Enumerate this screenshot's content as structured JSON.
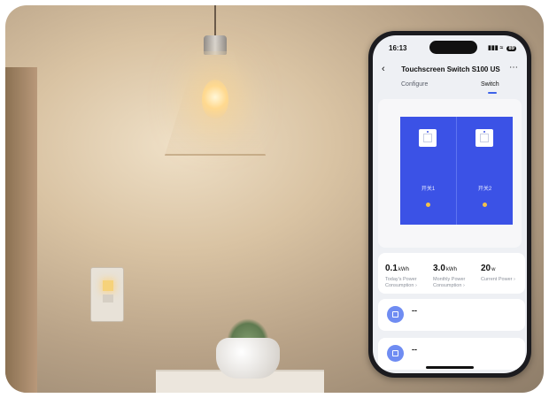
{
  "status": {
    "time": "16:13",
    "signal_icon": "signal-icon",
    "wifi_icon": "wifi-icon",
    "battery": "89"
  },
  "header": {
    "title": "Touchscreen Switch S100 US"
  },
  "tabs": [
    {
      "label": "Configure",
      "active": false
    },
    {
      "label": "Switch",
      "active": true
    }
  ],
  "device": {
    "switches": [
      {
        "label": "开关1"
      },
      {
        "label": "开关2"
      }
    ]
  },
  "stats": [
    {
      "value": "0.1",
      "unit": "kWh",
      "label": "Today's Power Consumption"
    },
    {
      "value": "3.0",
      "unit": "kWh",
      "label": "Monthly Power Consumption"
    },
    {
      "value": "20",
      "unit": "w",
      "label": "Current Power"
    }
  ],
  "rows": [
    {
      "value": "--"
    },
    {
      "value": "--"
    }
  ],
  "colors": {
    "accent": "#3b52e6",
    "tab_underline": "#3c62e8",
    "led": "#f2c14a"
  }
}
